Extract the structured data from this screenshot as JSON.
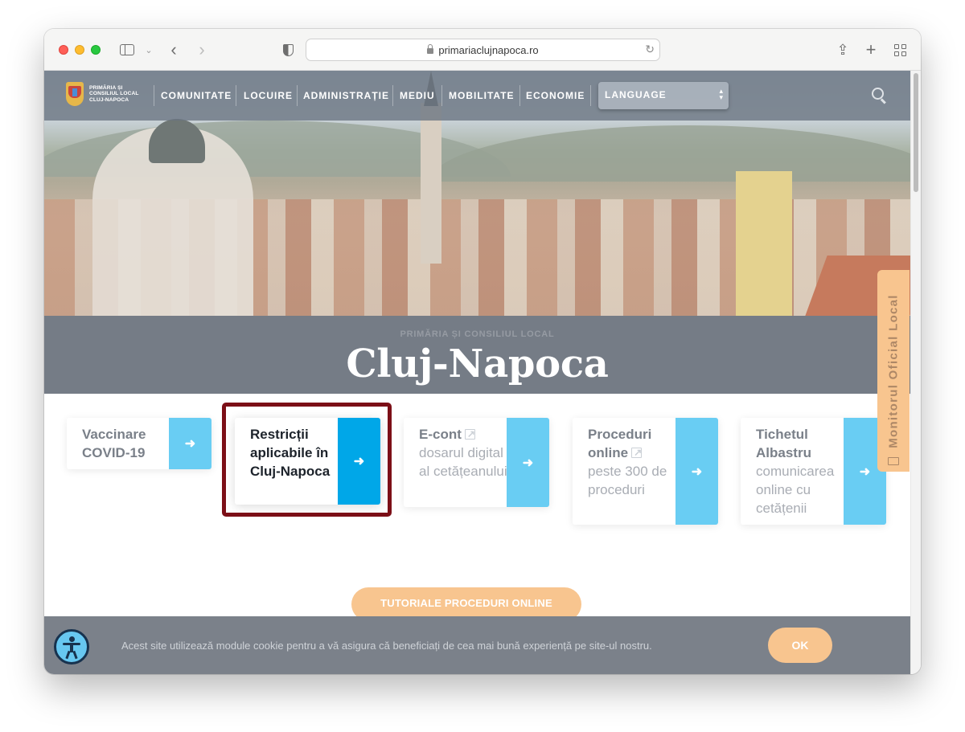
{
  "browser": {
    "url": "primariaclujnapoca.ro"
  },
  "nav": {
    "logo_lines": [
      "PRIMĂRIA ȘI",
      "CONSILIUL LOCAL",
      "CLUJ-NAPOCA"
    ],
    "items": [
      {
        "label": "COMUNITATE"
      },
      {
        "label": "LOCUIRE"
      },
      {
        "label": "ADMINISTRAȚIE"
      },
      {
        "label": "MEDIU"
      },
      {
        "label": "MOBILITATE"
      },
      {
        "label": "ECONOMIE"
      }
    ],
    "language_select": "LANGUAGE"
  },
  "title_band": {
    "subtitle": "PRIMĂRIA ȘI CONSILIUL LOCAL",
    "title": "Cluj-Napoca"
  },
  "cards": [
    {
      "title": "Vaccinare COVID-19",
      "desc": ""
    },
    {
      "title": "Restricții aplicabile în Cluj-Napoca",
      "desc": "",
      "highlighted": true
    },
    {
      "title": "E-cont",
      "desc": "dosarul digital al cetățeanului",
      "external": true
    },
    {
      "title": "Proceduri online",
      "desc": "peste 300 de proceduri",
      "external": true
    },
    {
      "title": "Tichetul Albastru",
      "desc": "comunicarea online cu cetățenii"
    }
  ],
  "card_arrow": "➜",
  "side_tab": {
    "label": "Monitorul Oficial Local"
  },
  "tutorial_button": "TUTORIALE PROCEDURI ONLINE",
  "cookie": {
    "message": "Acest site utilizează module cookie pentru a vă asigura că beneficiați de cea mai bună experiență pe site-ul nostru.",
    "ok_label": "OK"
  },
  "colors": {
    "accent_blue": "#00a7e8",
    "light_blue": "#69cdf3",
    "orange": "#f8c58f",
    "highlight_border": "#7c0f17"
  }
}
